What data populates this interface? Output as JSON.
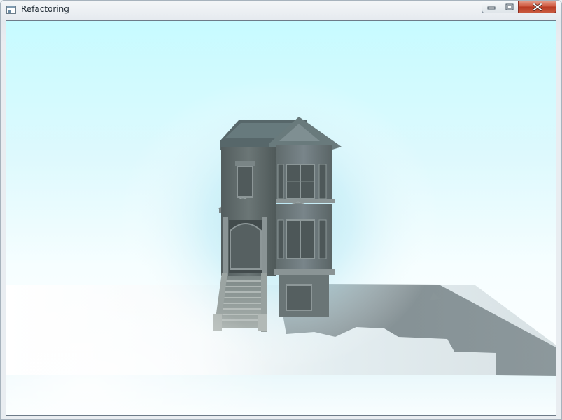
{
  "window": {
    "title": "Refactoring",
    "controls": {
      "minimize_icon": "minimize-icon",
      "maximize_icon": "maximize-icon",
      "close_icon": "close-icon"
    }
  },
  "viewport": {
    "scene": "house",
    "colors": {
      "sky_top": "#c9fbff",
      "sky_glow": "#b7ebf6",
      "ground": "#ffffff",
      "shadow": "#8e999d",
      "house": "#5f6a6b"
    }
  }
}
